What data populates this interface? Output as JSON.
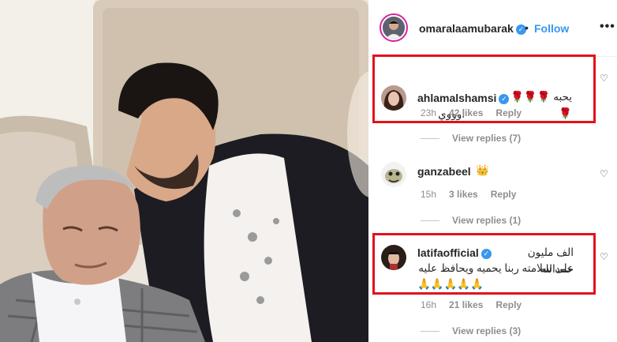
{
  "post": {
    "username": "omaralaamubarak",
    "separator": "•",
    "follow_label": "Follow",
    "more_glyph": "•••",
    "verified_glyph": "✓"
  },
  "comments": [
    {
      "username": "ahlamalshamsi",
      "verified": true,
      "line1": "يحبه 🌹🌹🌹🌹",
      "line2": "اوووي",
      "time": "23h",
      "likes": "42 likes",
      "reply": "Reply",
      "view_replies": "View replies (7)"
    },
    {
      "username": "ganzabeel",
      "verified": false,
      "line1": "👑",
      "time": "15h",
      "likes": "3 likes",
      "reply": "Reply",
      "view_replies": "View replies (1)"
    },
    {
      "username": "latifaofficial",
      "verified": true,
      "line1": "الف مليون حمدالله",
      "line2": "على سلامته ربنا يحميه ويحافظ عليه",
      "line3": "🙏🙏🙏🙏🙏",
      "time": "16h",
      "likes": "21 likes",
      "reply": "Reply",
      "view_replies": "View replies (3)"
    }
  ],
  "icons": {
    "heart": "♡",
    "crown": "👑"
  },
  "colors": {
    "highlight": "#e1121b",
    "follow": "#3897f0",
    "verified": "#3897f0",
    "meta_text": "#8e8e8e"
  }
}
